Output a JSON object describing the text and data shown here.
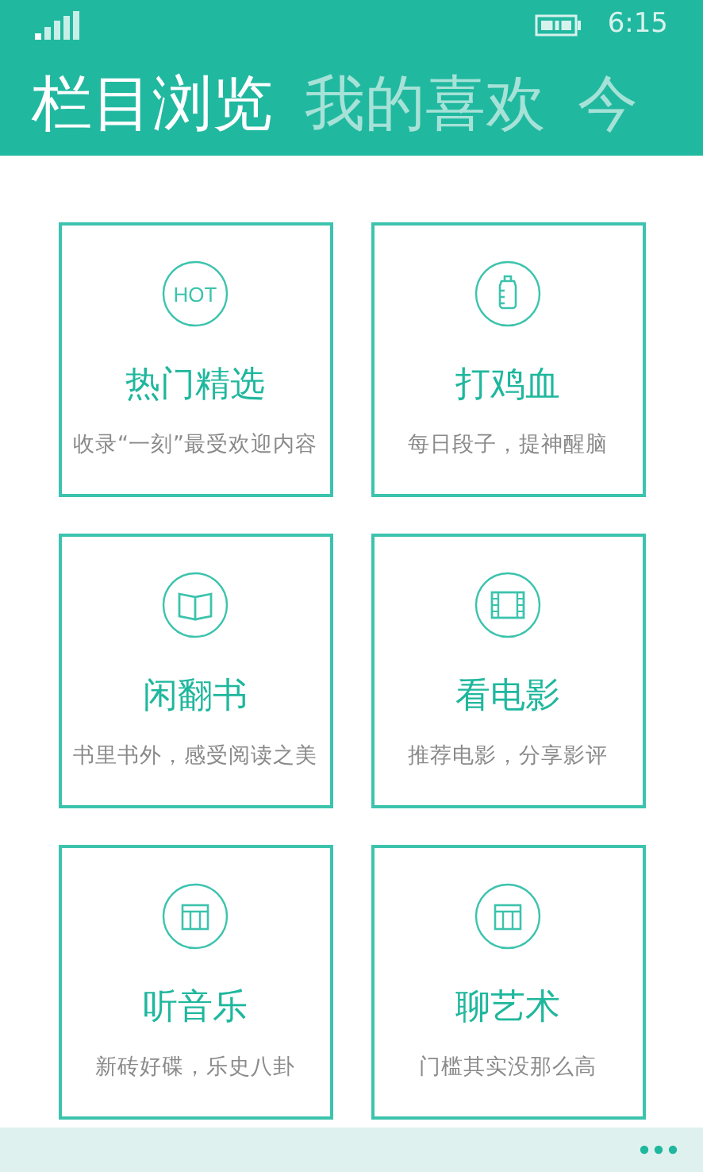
{
  "status_bar": {
    "time": "6:15"
  },
  "pivot": [
    {
      "label": "栏目浏览",
      "selected": true
    },
    {
      "label": "我的喜欢",
      "selected": false
    },
    {
      "label": "今",
      "selected": false
    }
  ],
  "cards": [
    {
      "kind": "text",
      "icon_text": "HOT",
      "title": "热门精选",
      "subtitle": "收录“一刻”最受欢迎内容"
    },
    {
      "kind": "bottle",
      "title": "打鸡血",
      "subtitle": "每日段子，提神醒脑"
    },
    {
      "kind": "book",
      "title": "闲翻书",
      "subtitle": "书里书外，感受阅读之美"
    },
    {
      "kind": "film",
      "title": "看电影",
      "subtitle": "推荐电影，分享影评"
    },
    {
      "kind": "grid",
      "title": "听音乐",
      "subtitle": "新砖好碟，乐史八卦"
    },
    {
      "kind": "grid",
      "title": "聊艺术",
      "subtitle": "门槛其实没那么高"
    }
  ]
}
